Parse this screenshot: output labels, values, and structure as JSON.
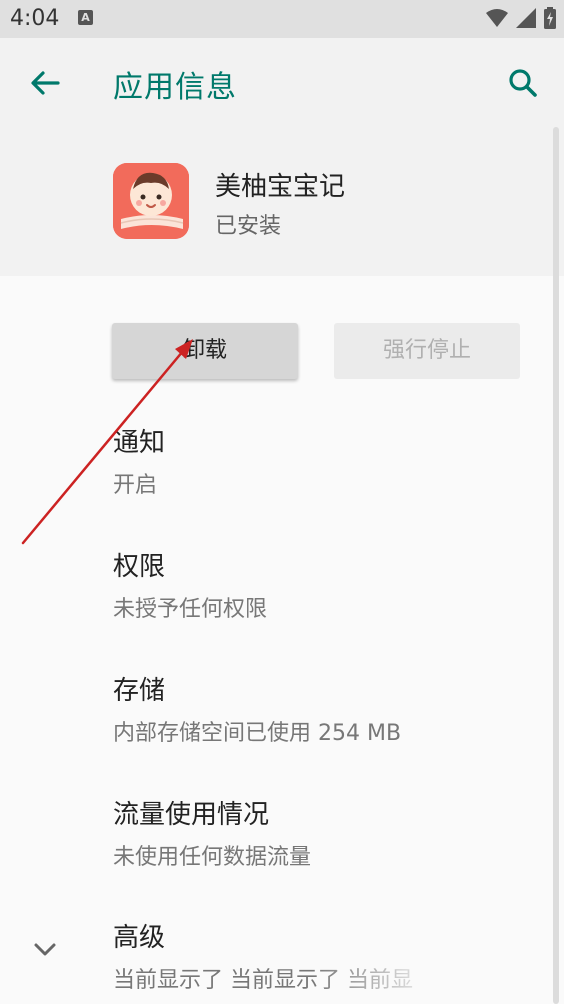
{
  "status_bar": {
    "time": "4:04",
    "notification_badge": "A",
    "icons": [
      "wifi-icon",
      "signal-icon",
      "battery-icon"
    ]
  },
  "header": {
    "title": "应用信息",
    "back_icon": "arrow-left-icon",
    "search_icon": "search-icon"
  },
  "app": {
    "name": "美柚宝宝记",
    "status": "已安装"
  },
  "buttons": {
    "uninstall": "卸载",
    "force_stop": "强行停止"
  },
  "settings": [
    {
      "title": "通知",
      "subtitle": "开启"
    },
    {
      "title": "权限",
      "subtitle": "未授予任何权限"
    },
    {
      "title": "存储",
      "subtitle": "内部存储空间已使用 254 MB"
    },
    {
      "title": "流量使用情况",
      "subtitle": "未使用任何数据流量"
    },
    {
      "title": "高级",
      "subtitle": "当前显示了 当前显示了 当前显"
    }
  ],
  "colors": {
    "accent": "#00796b",
    "annotation_arrow": "#cc2222",
    "app_icon_bg": "#f26b5b"
  }
}
